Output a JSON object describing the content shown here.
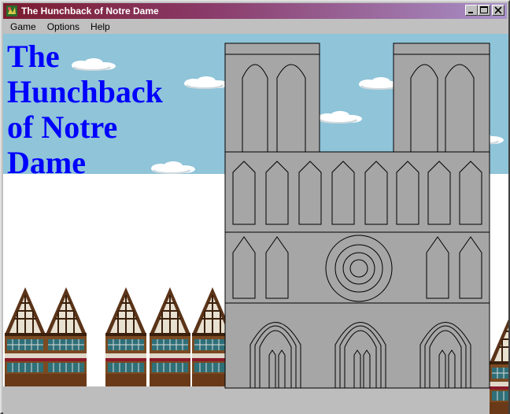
{
  "window": {
    "title": "The Hunchback of Notre Dame"
  },
  "menu": {
    "items": [
      "Game",
      "Options",
      "Help"
    ]
  },
  "game": {
    "title_text": "The\nHunchback\nof Notre\nDame",
    "title_color": "#0000ff",
    "sky_color": "#8fc4d9",
    "cathedral_color": "#a6a6a6"
  }
}
